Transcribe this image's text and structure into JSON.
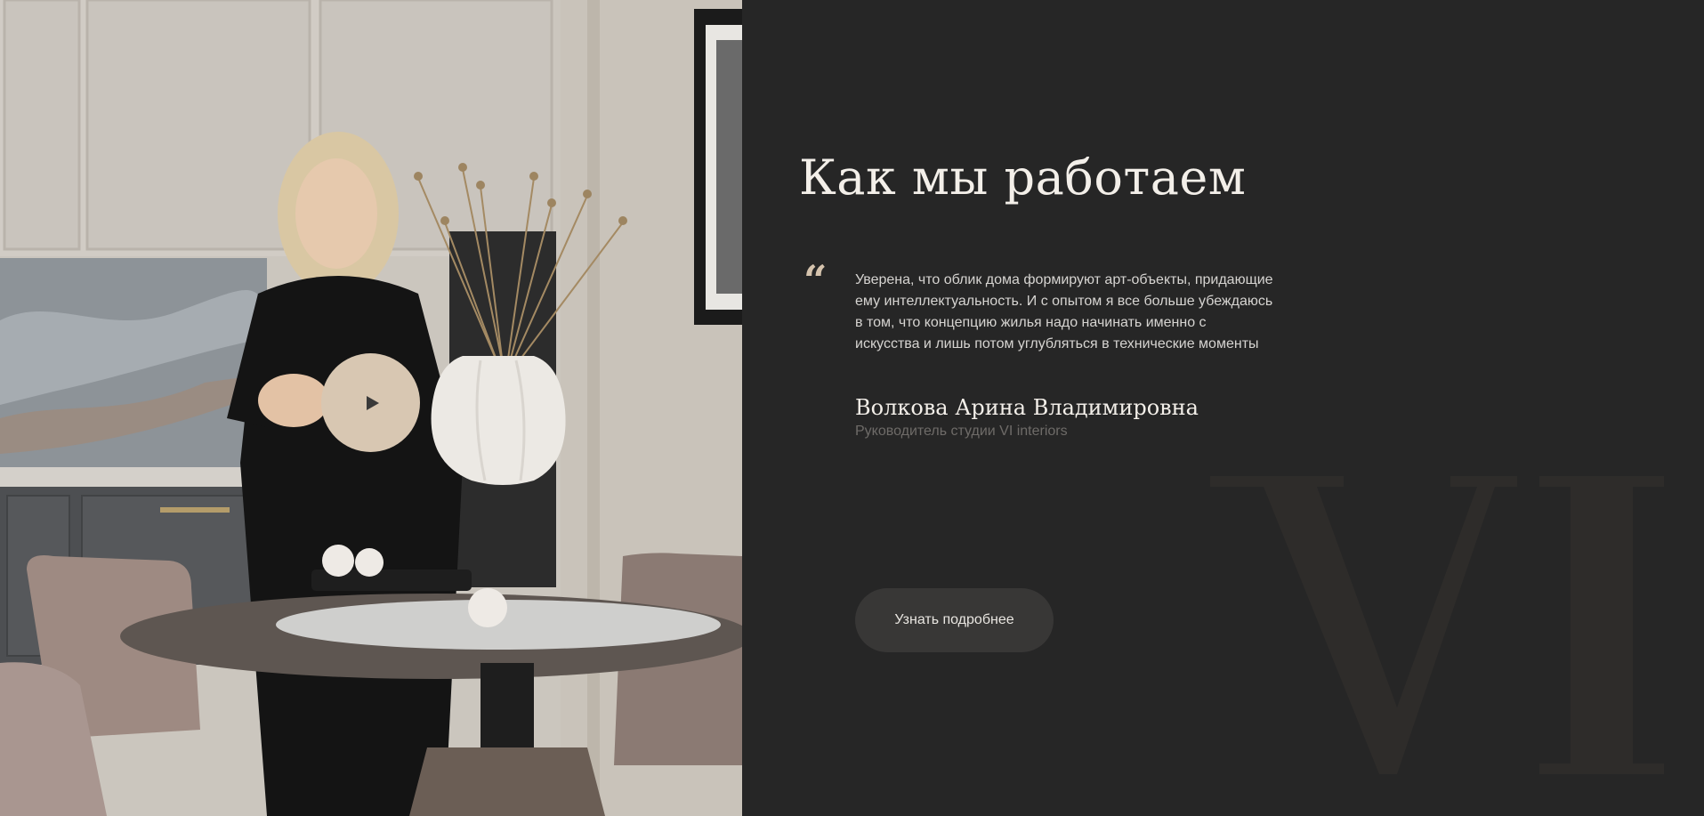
{
  "section": {
    "title": "Как мы работаем"
  },
  "quote": {
    "mark": "“",
    "text": "Уверена, что облик дома формируют арт-объекты, придающие ему интеллектуальность. И с опытом я все больше убеждаюсь в том, что концепцию жилья надо начинать именно с искусства и лишь потом углубляться в технические моменты"
  },
  "author": {
    "name": "Волкова Арина Владимировна",
    "role": "Руководитель студии VI interiors"
  },
  "cta": {
    "label": "Узнать подробнее"
  },
  "watermark": {
    "text": "VI"
  },
  "video": {
    "play_icon": "play-icon"
  },
  "colors": {
    "background": "#262626",
    "accent": "#d8c7b2",
    "button_bg": "#383736"
  }
}
